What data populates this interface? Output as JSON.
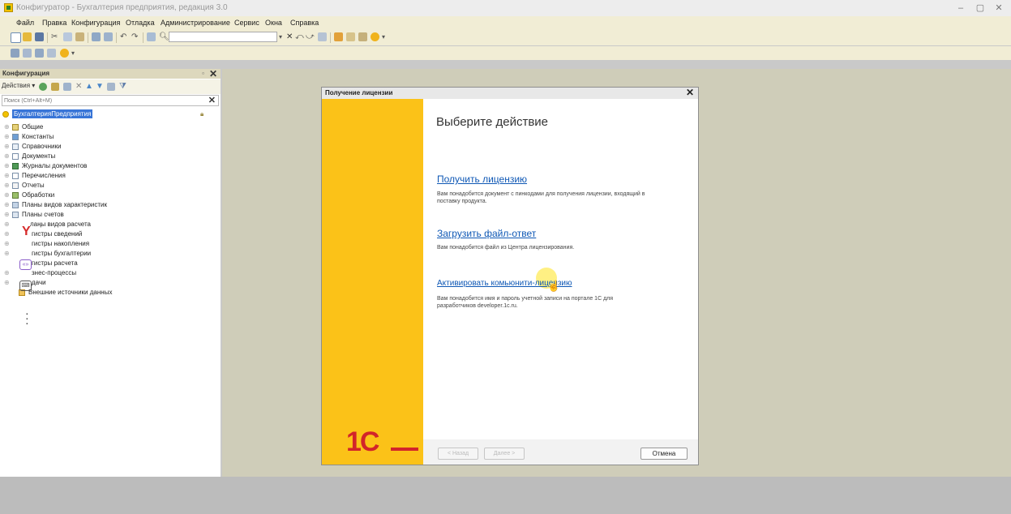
{
  "window": {
    "title": "Конфигуратор - Бухгалтерия предприятия, редакция 3.0",
    "controls": {
      "minimize": "–",
      "maximize": "▢",
      "close": "✕"
    }
  },
  "menu": [
    "Файл",
    "Правка",
    "Конфигурация",
    "Отладка",
    "Администрирование",
    "Сервис",
    "Окна",
    "Справка"
  ],
  "panel": {
    "title": "Конфигурация",
    "actions_label": "Действия ▾",
    "search_placeholder": "Поиск (Ctrl+Alt+M)",
    "root_label": "БухгалтерияПредприятия",
    "items": [
      "Общие",
      "Константы",
      "Справочники",
      "Документы",
      "Журналы документов",
      "Перечисления",
      "Отчеты",
      "Обработки",
      "Планы видов характеристик",
      "Планы счетов",
      "лаңы видов расчета",
      "гистры сведений",
      "гистры накопления",
      "гистры бухгалтерии",
      "гистры расчета",
      "знес-процессы",
      "дачи",
      "Внешние источники данных"
    ]
  },
  "dialog": {
    "title": "Получение лицензии",
    "heading": "Выберите действие",
    "options": [
      {
        "link": "Получить лицензию",
        "desc": "Вам понадобится документ с пинкодами для получения лицензии, входящий в поставку продукта."
      },
      {
        "link": "Загрузить файл-ответ",
        "desc": "Вам понадобится файл из Центра лицензирования."
      },
      {
        "link": "Активировать комьюнити-лицензию",
        "desc": "Вам понадобится имя и пароль учетной записи на портале 1С для разработчиков developer.1c.ru."
      }
    ],
    "logo_text": "1С",
    "buttons": {
      "back": "< Назад",
      "next": "Далее >",
      "cancel": "Отмена"
    }
  },
  "icons": {
    "overlay": [
      "yandex-browser-icon",
      "chat-icon",
      "keyboard-icon",
      "more-vertical-icon"
    ]
  },
  "colors": {
    "menu_bg": "#f1edd5",
    "dialog_side": "#fbc218",
    "logo_red": "#d2242a",
    "link_blue": "#0f58b5",
    "selection": "#3875d7"
  }
}
